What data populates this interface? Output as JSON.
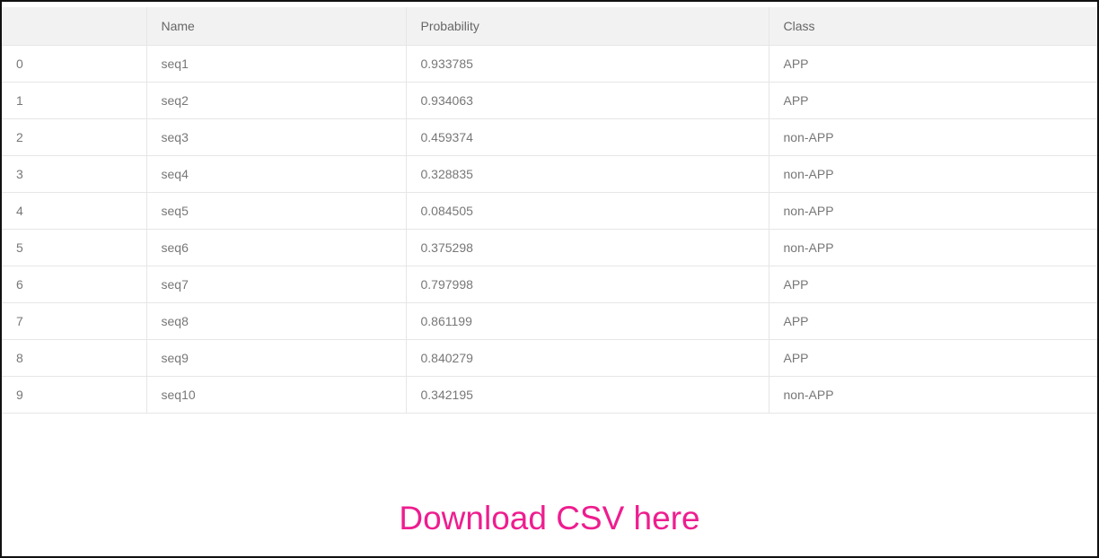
{
  "table": {
    "headers": [
      "",
      "Name",
      "Probability",
      "Class"
    ],
    "rows": [
      [
        "0",
        "seq1",
        "0.933785",
        "APP"
      ],
      [
        "1",
        "seq2",
        "0.934063",
        "APP"
      ],
      [
        "2",
        "seq3",
        "0.459374",
        "non-APP"
      ],
      [
        "3",
        "seq4",
        "0.328835",
        "non-APP"
      ],
      [
        "4",
        "seq5",
        "0.084505",
        "non-APP"
      ],
      [
        "5",
        "seq6",
        "0.375298",
        "non-APP"
      ],
      [
        "6",
        "seq7",
        "0.797998",
        "APP"
      ],
      [
        "7",
        "seq8",
        "0.861199",
        "APP"
      ],
      [
        "8",
        "seq9",
        "0.840279",
        "APP"
      ],
      [
        "9",
        "seq10",
        "0.342195",
        "non-APP"
      ]
    ]
  },
  "download": {
    "label": "Download CSV here"
  },
  "colors": {
    "link": "#ee1d8f",
    "header_bg": "#f2f2f2",
    "text": "#777777",
    "border": "#111111"
  }
}
